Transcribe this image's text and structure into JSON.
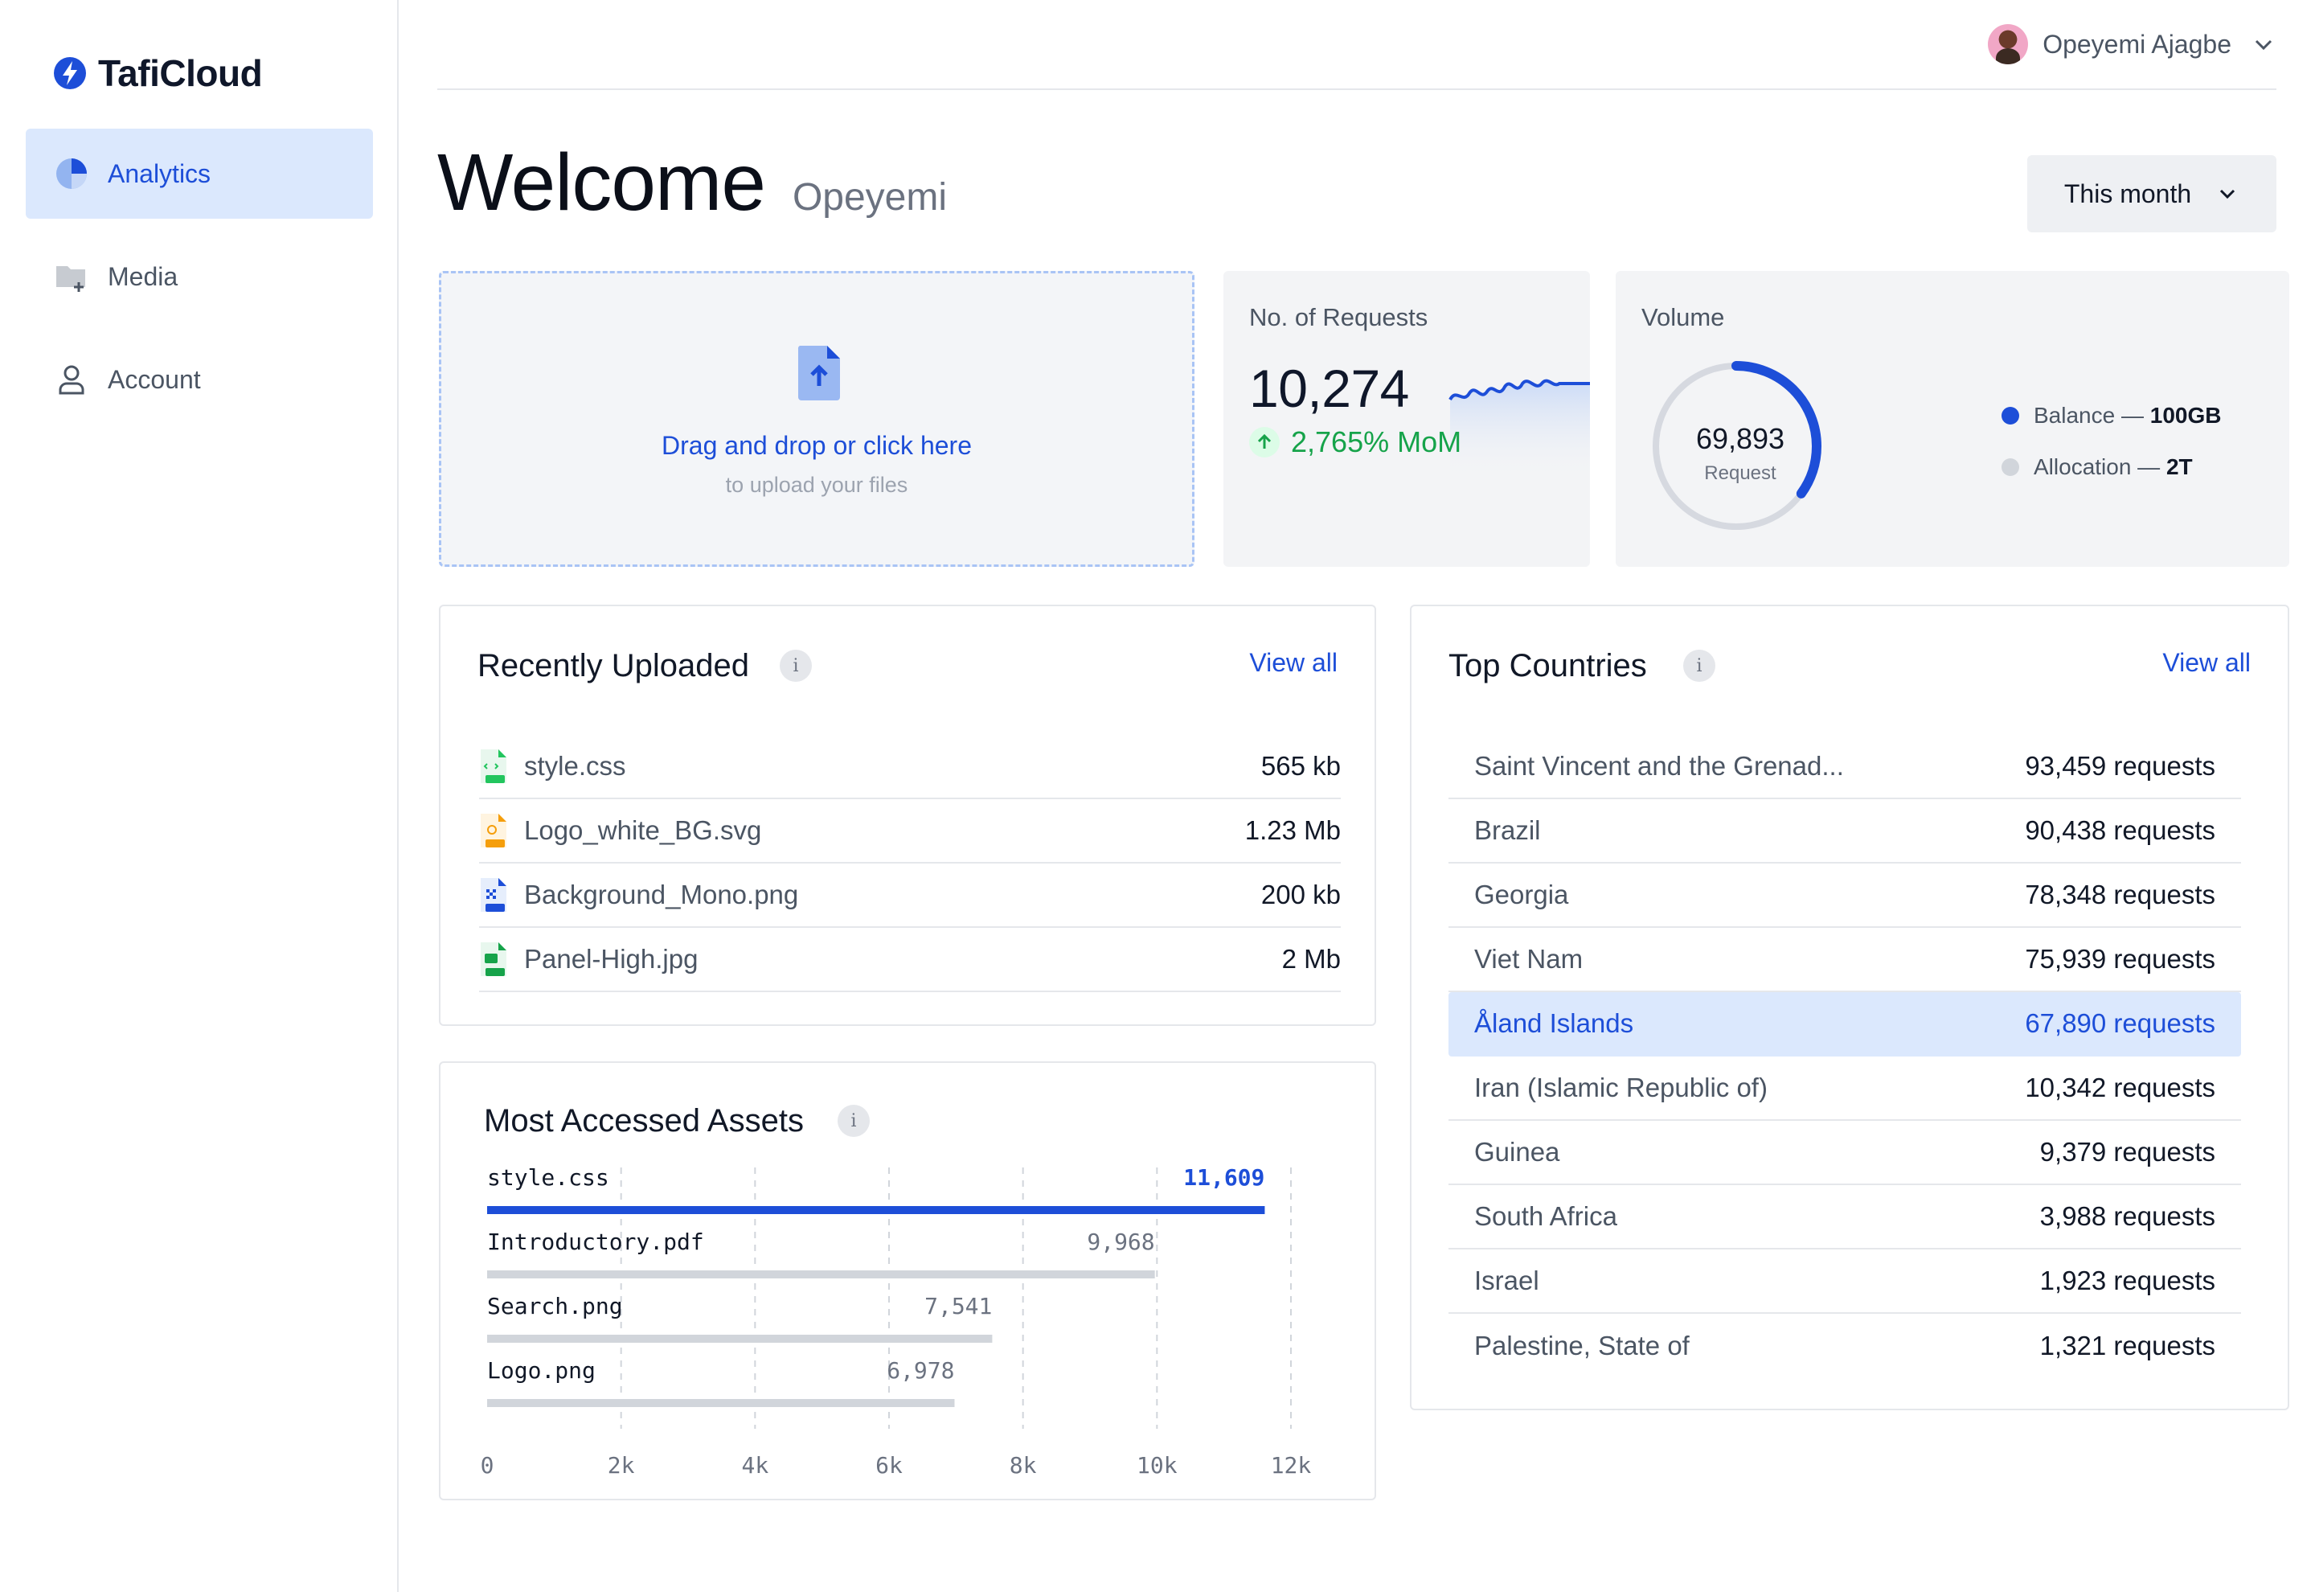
{
  "brand": {
    "name": "TafiCloud"
  },
  "sidebar": {
    "items": [
      {
        "label": "Analytics",
        "icon": "pie-chart-icon",
        "active": true
      },
      {
        "label": "Media",
        "icon": "folder-add-icon",
        "active": false
      },
      {
        "label": "Account",
        "icon": "user-icon",
        "active": false
      }
    ]
  },
  "user": {
    "name": "Opeyemi Ajagbe"
  },
  "header": {
    "title": "Welcome",
    "name": "Opeyemi",
    "period": "This month"
  },
  "upload": {
    "main": "Drag and drop or click here",
    "sub": "to upload your files"
  },
  "requests": {
    "label": "No. of Requests",
    "value": "10,274",
    "change": "2,765% MoM"
  },
  "volume": {
    "label": "Volume",
    "donut_value": "69,893",
    "donut_label": "Request",
    "donut_fraction": 0.35,
    "legend": [
      {
        "label": "Balance",
        "value": "100GB",
        "color": "#1d4ed8"
      },
      {
        "label": "Allocation",
        "value": "2T",
        "color": "#d1d5db"
      }
    ]
  },
  "recent": {
    "title": "Recently Uploaded",
    "view_all": "View all",
    "files": [
      {
        "name": "style.css",
        "size": "565 kb",
        "type": "css"
      },
      {
        "name": "Logo_white_BG.svg",
        "size": "1.23 Mb",
        "type": "svg"
      },
      {
        "name": "Background_Mono.png",
        "size": "200 kb",
        "type": "png"
      },
      {
        "name": "Panel-High.jpg",
        "size": "2 Mb",
        "type": "jpg"
      }
    ]
  },
  "assets": {
    "title": "Most Accessed Assets",
    "chart_data": {
      "type": "bar",
      "orientation": "horizontal",
      "categories": [
        "style.css",
        "Introductory.pdf",
        "Search.png",
        "Logo.png"
      ],
      "values": [
        11609,
        9968,
        7541,
        6978
      ],
      "value_labels": [
        "11,609",
        "9,968",
        "7,541",
        "6,978"
      ],
      "xlim": [
        0,
        12000
      ],
      "ticks": [
        0,
        2000,
        4000,
        6000,
        8000,
        10000,
        12000
      ],
      "tick_labels": [
        "0",
        "2k",
        "4k",
        "6k",
        "8k",
        "10k",
        "12k"
      ],
      "grid": "vertical dashed",
      "colors": {
        "highlight": "#1d4ed8",
        "default": "#d1d5db"
      }
    }
  },
  "countries": {
    "title": "Top Countries",
    "view_all": "View all",
    "rows": [
      {
        "name": "Saint Vincent and the Grenad...",
        "value": "93,459 requests"
      },
      {
        "name": "Brazil",
        "value": "90,438 requests"
      },
      {
        "name": "Georgia",
        "value": "78,348 requests"
      },
      {
        "name": "Viet Nam",
        "value": "75,939 requests"
      },
      {
        "name": "Åland Islands",
        "value": "67,890 requests",
        "highlight": true
      },
      {
        "name": "Iran (Islamic Republic of)",
        "value": "10,342 requests"
      },
      {
        "name": "Guinea",
        "value": "9,379 requests"
      },
      {
        "name": "South Africa",
        "value": "3,988 requests"
      },
      {
        "name": "Israel",
        "value": "1,923 requests"
      },
      {
        "name": "Palestine, State of",
        "value": "1,321 requests"
      }
    ]
  },
  "colors": {
    "accent": "#1d4ed8",
    "accent_light": "#dbe8fd",
    "success": "#16a34a"
  }
}
